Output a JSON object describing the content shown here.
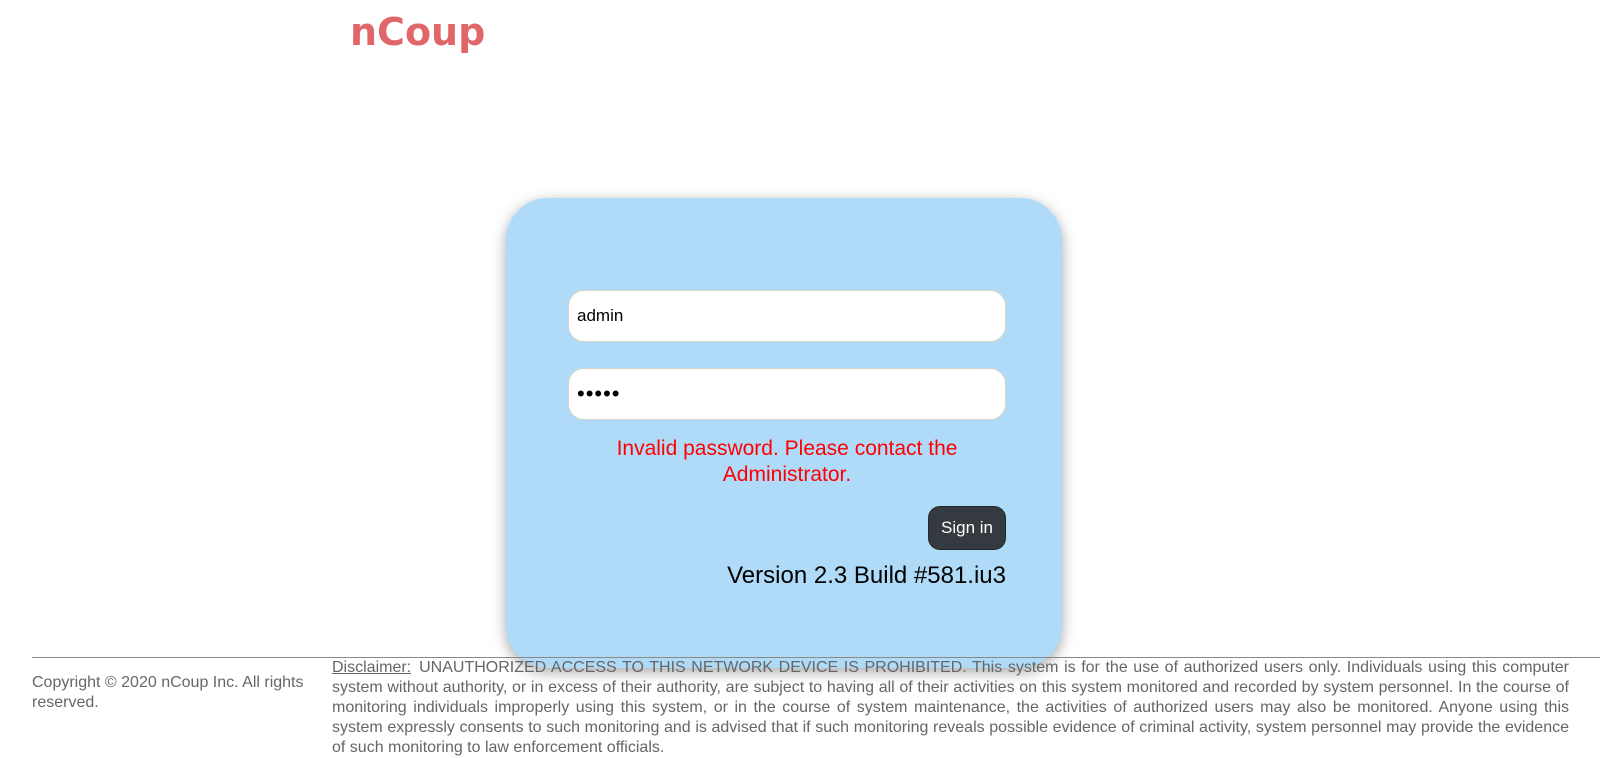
{
  "header": {
    "logo_text": "nCoup"
  },
  "login": {
    "username_value": "admin",
    "password_value": "•••••",
    "error_message": "Invalid password. Please contact the Administrator.",
    "signin_label": "Sign in",
    "version_text": "Version 2.3 Build #581.iu3"
  },
  "footer": {
    "copyright": "Copyright © 2020 nCoup Inc. All rights reserved.",
    "disclaimer_label": "Disclaimer:",
    "disclaimer_text": "UNAUTHORIZED ACCESS TO THIS NETWORK DEVICE IS PROHIBITED.  This system is for the use of authorized users only. Individuals using this computer system without authority, or in excess of their authority, are subject to having all of their activities on this system monitored and recorded by system personnel. In the course of monitoring individuals improperly using this system, or in the course of system maintenance, the activities of authorized users may also be monitored. Anyone using this system expressly consents to such monitoring and is advised that if such monitoring reveals possible evidence of criminal activity, system personnel may provide the evidence of such monitoring to law enforcement officials."
  },
  "colors": {
    "logo": "#e0666a",
    "card_background": "#b0dbf8",
    "error": "#ff0000",
    "button_background": "#343a40",
    "footer_text": "#666666"
  }
}
